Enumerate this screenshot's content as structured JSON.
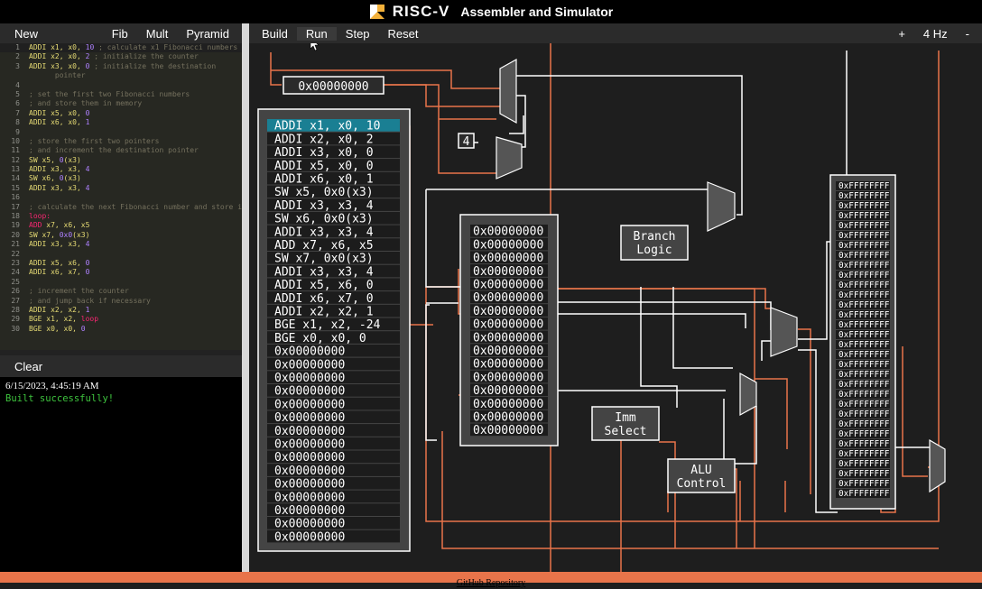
{
  "titlebar": {
    "logo_text": "RISC-V",
    "app_title": "Assembler and Simulator"
  },
  "editor_toolbar": {
    "new": "New",
    "fib": "Fib",
    "mult": "Mult",
    "pyramid": "Pyramid"
  },
  "code_lines": [
    {
      "n": "1",
      "segs": [
        [
          "code",
          "ADDI x1, x0, "
        ],
        [
          "num",
          "10"
        ],
        [
          "cm",
          " ; calculate x1 Fibonacci numbers"
        ]
      ]
    },
    {
      "n": "2",
      "segs": [
        [
          "code",
          "ADDI x2, x0, "
        ],
        [
          "num",
          "2"
        ],
        [
          "cm",
          " ; initialize the counter"
        ]
      ]
    },
    {
      "n": "3",
      "segs": [
        [
          "code",
          "ADDI x3, x0, "
        ],
        [
          "num",
          "0"
        ],
        [
          "cm",
          " ; initialize the destination"
        ]
      ]
    },
    {
      "n": "",
      "segs": [
        [
          "cm",
          "      pointer"
        ]
      ]
    },
    {
      "n": "4",
      "segs": []
    },
    {
      "n": "5",
      "segs": [
        [
          "cm",
          "; set the first two Fibonacci numbers"
        ]
      ]
    },
    {
      "n": "6",
      "segs": [
        [
          "cm",
          "; and store them in memory"
        ]
      ]
    },
    {
      "n": "7",
      "segs": [
        [
          "code",
          "ADDI x5, x0, "
        ],
        [
          "num",
          "0"
        ]
      ]
    },
    {
      "n": "8",
      "segs": [
        [
          "code",
          "ADDI x6, x0, "
        ],
        [
          "num",
          "1"
        ]
      ]
    },
    {
      "n": "9",
      "segs": []
    },
    {
      "n": "10",
      "segs": [
        [
          "cm",
          "; store the first two pointers"
        ]
      ]
    },
    {
      "n": "11",
      "segs": [
        [
          "cm",
          "; and increment the destination pointer"
        ]
      ]
    },
    {
      "n": "12",
      "segs": [
        [
          "code",
          "SW x5, "
        ],
        [
          "num",
          "0"
        ],
        [
          "code",
          "(x3)"
        ]
      ]
    },
    {
      "n": "13",
      "segs": [
        [
          "code",
          "ADDI x3, x3, "
        ],
        [
          "num",
          "4"
        ]
      ]
    },
    {
      "n": "14",
      "segs": [
        [
          "code",
          "SW x6, "
        ],
        [
          "num",
          "0"
        ],
        [
          "code",
          "(x3)"
        ]
      ]
    },
    {
      "n": "15",
      "segs": [
        [
          "code",
          "ADDI x3, x3, "
        ],
        [
          "num",
          "4"
        ]
      ]
    },
    {
      "n": "16",
      "segs": []
    },
    {
      "n": "17",
      "segs": [
        [
          "cm",
          "; calculate the next Fibonacci number and store it"
        ]
      ]
    },
    {
      "n": "18",
      "segs": [
        [
          "kw-red",
          "loop:"
        ]
      ]
    },
    {
      "n": "19",
      "segs": [
        [
          "kw-red",
          "ADD"
        ],
        [
          "code",
          " x7, x6, x5"
        ]
      ]
    },
    {
      "n": "20",
      "segs": [
        [
          "code",
          "SW x7, "
        ],
        [
          "num",
          "0x0"
        ],
        [
          "code",
          "(x3)"
        ]
      ]
    },
    {
      "n": "21",
      "segs": [
        [
          "code",
          "ADDI x3, x3, "
        ],
        [
          "num",
          "4"
        ]
      ]
    },
    {
      "n": "22",
      "segs": []
    },
    {
      "n": "23",
      "segs": [
        [
          "code",
          "ADDI x5, x6, "
        ],
        [
          "num",
          "0"
        ]
      ]
    },
    {
      "n": "24",
      "segs": [
        [
          "code",
          "ADDI x6, x7, "
        ],
        [
          "num",
          "0"
        ]
      ]
    },
    {
      "n": "25",
      "segs": []
    },
    {
      "n": "26",
      "segs": [
        [
          "cm",
          "; increment the counter"
        ]
      ]
    },
    {
      "n": "27",
      "segs": [
        [
          "cm",
          "; and jump back if necessary"
        ]
      ]
    },
    {
      "n": "28",
      "segs": [
        [
          "code",
          "ADDI x2, x2, "
        ],
        [
          "num",
          "1"
        ]
      ]
    },
    {
      "n": "29",
      "segs": [
        [
          "code",
          "BGE x1, x2, "
        ],
        [
          "kw-red",
          "loop"
        ]
      ]
    },
    {
      "n": "30",
      "segs": [
        [
          "code",
          "BGE x0, x0, "
        ],
        [
          "num",
          "0"
        ]
      ]
    }
  ],
  "console": {
    "clear": "Clear",
    "timestamp": "6/15/2023, 4:45:19 AM",
    "message": "Built successfully!"
  },
  "sim_toolbar": {
    "build": "Build",
    "run": "Run",
    "step": "Step",
    "reset": "Reset",
    "plus": "+",
    "freq": "4 Hz",
    "minus": "-"
  },
  "pc": "0x00000000",
  "pc_increment": "4",
  "instructions": [
    "ADDI x1, x0, 10",
    "ADDI x2, x0, 2",
    "ADDI x3, x0, 0",
    "ADDI x5, x0, 0",
    "ADDI x6, x0, 1",
    "SW x5, 0x0(x3)",
    "ADDI x3, x3, 4",
    "SW x6, 0x0(x3)",
    "ADDI x3, x3, 4",
    "ADD x7, x6, x5",
    "SW x7, 0x0(x3)",
    "ADDI x3, x3, 4",
    "ADDI x5, x6, 0",
    "ADDI x6, x7, 0",
    "ADDI x2, x2, 1",
    "BGE x1, x2, -24",
    "BGE x0, x0, 0",
    "0x00000000",
    "0x00000000",
    "0x00000000",
    "0x00000000",
    "0x00000000",
    "0x00000000",
    "0x00000000",
    "0x00000000",
    "0x00000000",
    "0x00000000",
    "0x00000000",
    "0x00000000",
    "0x00000000",
    "0x00000000",
    "0x00000000"
  ],
  "registers": [
    "0x00000000",
    "0x00000000",
    "0x00000000",
    "0x00000000",
    "0x00000000",
    "0x00000000",
    "0x00000000",
    "0x00000000",
    "0x00000000",
    "0x00000000",
    "0x00000000",
    "0x00000000",
    "0x00000000",
    "0x00000000",
    "0x00000000",
    "0x00000000"
  ],
  "memory": [
    "0xFFFFFFFF",
    "0xFFFFFFFF",
    "0xFFFFFFFF",
    "0xFFFFFFFF",
    "0xFFFFFFFF",
    "0xFFFFFFFF",
    "0xFFFFFFFF",
    "0xFFFFFFFF",
    "0xFFFFFFFF",
    "0xFFFFFFFF",
    "0xFFFFFFFF",
    "0xFFFFFFFF",
    "0xFFFFFFFF",
    "0xFFFFFFFF",
    "0xFFFFFFFF",
    "0xFFFFFFFF",
    "0xFFFFFFFF",
    "0xFFFFFFFF",
    "0xFFFFFFFF",
    "0xFFFFFFFF",
    "0xFFFFFFFF",
    "0xFFFFFFFF",
    "0xFFFFFFFF",
    "0xFFFFFFFF",
    "0xFFFFFFFF",
    "0xFFFFFFFF",
    "0xFFFFFFFF",
    "0xFFFFFFFF",
    "0xFFFFFFFF",
    "0xFFFFFFFF",
    "0xFFFFFFFF",
    "0xFFFFFFFF"
  ],
  "labels": {
    "branch_logic_1": "Branch",
    "branch_logic_2": "Logic",
    "imm_select_1": "Imm",
    "imm_select_2": "Select",
    "alu_control_1": "ALU",
    "alu_control_2": "Control"
  },
  "footer": {
    "link": "GitHub Repository"
  },
  "colors": {
    "wire_orange": "#e8744a",
    "wire_white": "#ffffff",
    "highlight": "#1a7f93"
  }
}
